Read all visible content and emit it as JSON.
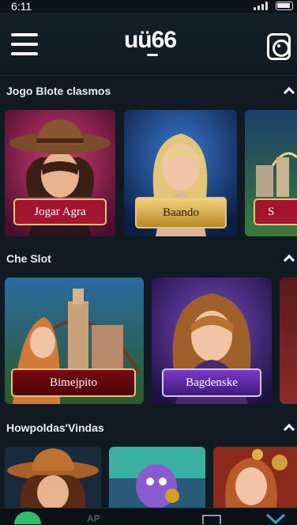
{
  "status": {
    "time": "6:11"
  },
  "header": {
    "logo": "uü66"
  },
  "sections": [
    {
      "title": "Jogo Blote clasmos",
      "cards": [
        {
          "button": "Jogar Agra"
        },
        {
          "button": "Baando"
        },
        {
          "button": "S"
        }
      ]
    },
    {
      "title": "Che Slot",
      "cards": [
        {
          "button": "Bimejpito"
        },
        {
          "button": "Bagdenske"
        }
      ]
    },
    {
      "title": "Howpoldas'Vindas",
      "cards": []
    }
  ],
  "tabbar": {
    "tab2_label": "AP"
  },
  "colors": {
    "background": "#0f1a22",
    "gold": "#e6c27a",
    "red_button": "#a3142f",
    "purple_button": "#5b2a9a"
  }
}
